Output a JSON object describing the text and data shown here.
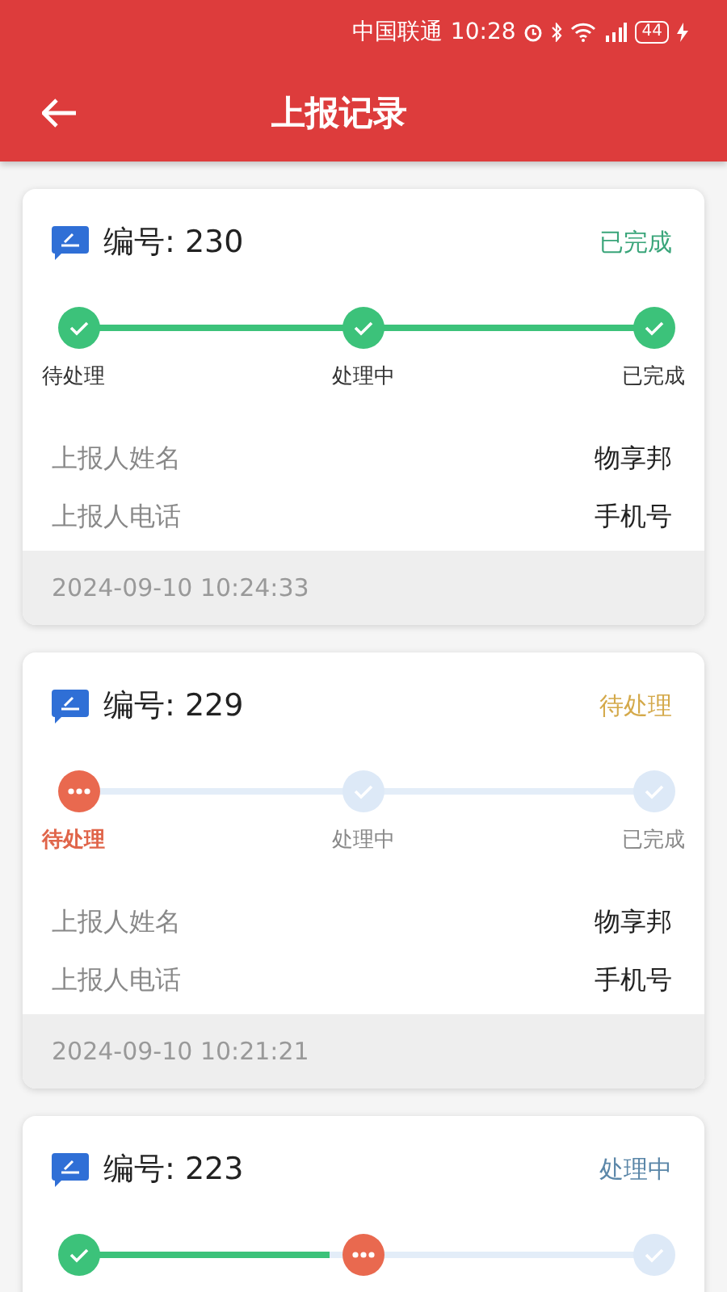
{
  "status_bar": {
    "carrier": "中国联通",
    "time": "10:28",
    "battery": "44"
  },
  "header": {
    "title": "上报记录"
  },
  "records": [
    {
      "number": "编号: 230",
      "status": {
        "label": "已完成",
        "color": "#3aa57a"
      },
      "steps": [
        {
          "kind": "done",
          "label": "待处理"
        },
        {
          "kind": "done",
          "label": "处理中"
        },
        {
          "kind": "done",
          "label": "已完成"
        }
      ],
      "fields": [
        {
          "label": "上报人姓名",
          "value": "物享邦"
        },
        {
          "label": "上报人电话",
          "value": "手机号"
        }
      ],
      "time": "2024-09-10 10:24:33"
    },
    {
      "number": "编号: 229",
      "status": {
        "label": "待处理",
        "color": "#d4a94a"
      },
      "steps": [
        {
          "kind": "current",
          "label": "待处理"
        },
        {
          "kind": "pending",
          "label": "处理中"
        },
        {
          "kind": "pending",
          "label": "已完成"
        }
      ],
      "fields": [
        {
          "label": "上报人姓名",
          "value": "物享邦"
        },
        {
          "label": "上报人电话",
          "value": "手机号"
        }
      ],
      "time": "2024-09-10 10:21:21"
    },
    {
      "number": "编号: 223",
      "status": {
        "label": "处理中",
        "color": "#5a86a8"
      },
      "steps": [
        {
          "kind": "done"
        },
        {
          "kind": "current"
        },
        {
          "kind": "pending"
        }
      ]
    }
  ]
}
